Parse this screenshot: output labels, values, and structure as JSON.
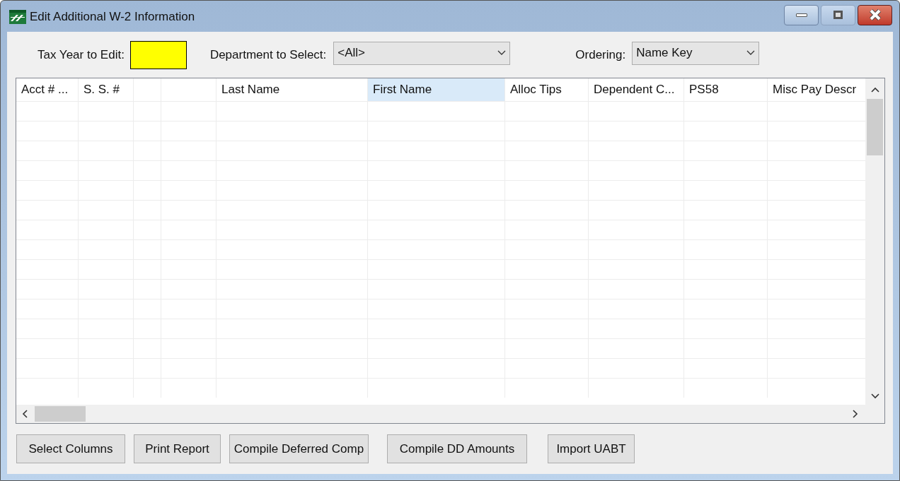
{
  "window": {
    "title": "Edit Additional W-2 Information"
  },
  "filters": {
    "tax_year_label": "Tax Year to Edit:",
    "department_label": "Department to Select:",
    "department": {
      "value": "<All>"
    },
    "ordering_label": "Ordering:",
    "ordering": {
      "value": "Name Key"
    }
  },
  "table": {
    "columns": [
      {
        "label": "Acct # ...",
        "selected": false
      },
      {
        "label": "S. S. #",
        "selected": false
      },
      {
        "selected": false
      },
      {
        "selected": false
      },
      {
        "label": "Last Name",
        "selected": false
      },
      {
        "label": "First Name",
        "selected": true
      },
      {
        "label": "Alloc Tips",
        "selected": false
      },
      {
        "label": "Dependent C...",
        "selected": false
      },
      {
        "label": "PS58",
        "selected": false
      },
      {
        "label": "Misc Pay Descr",
        "selected": false
      }
    ]
  },
  "buttons": [
    "Select Columns",
    "Print Report",
    "Compile Deferred Comp",
    "Compile DD Amounts",
    "Import UABT"
  ]
}
